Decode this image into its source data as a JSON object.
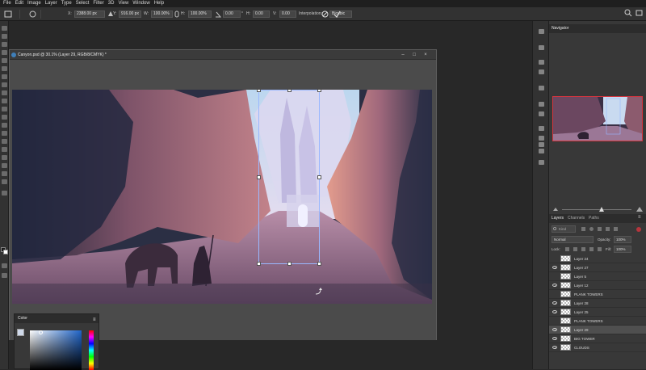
{
  "menu": [
    "File",
    "Edit",
    "Image",
    "Layer",
    "Type",
    "Select",
    "Filter",
    "3D",
    "View",
    "Window",
    "Help"
  ],
  "options": {
    "x_label": "X:",
    "x_value": "2388.00 px",
    "y_label": "Y:",
    "y_value": "916.00 px",
    "w_label": "W:",
    "w_value": "100.00%",
    "h_label": "H:",
    "h_value": "100.00%",
    "angle_value": "0.00",
    "h_skew_label": "H:",
    "h_skew_value": "0.00",
    "v_skew_label": "V:",
    "v_skew_value": "0.00",
    "interpolation_label": "Interpolation:",
    "interpolation_value": "Bicubic"
  },
  "document": {
    "title": "Canyon.psd @ 30.1% (Layer 29, RGB/8/CMYK) *"
  },
  "color_panel": {
    "title": "Color"
  },
  "navigator": {
    "title": "Navigator"
  },
  "layers_panel": {
    "tabs": [
      "Layers",
      "Channels",
      "Paths"
    ],
    "search_placeholder": "Kind",
    "blend_mode": "Normal",
    "opacity_label": "Opacity:",
    "opacity_value": "100%",
    "lock_label": "Lock:",
    "fill_label": "Fill:",
    "fill_value": "100%",
    "layers": [
      {
        "name": "Layer 24",
        "visible": false,
        "selected": false
      },
      {
        "name": "Layer 27",
        "visible": true,
        "selected": false
      },
      {
        "name": "Layer 5",
        "visible": false,
        "selected": false
      },
      {
        "name": "Layer 12",
        "visible": true,
        "selected": false
      },
      {
        "name": "PLANK TOWERS",
        "visible": false,
        "selected": false
      },
      {
        "name": "Layer 28",
        "visible": true,
        "selected": false
      },
      {
        "name": "Layer 25",
        "visible": true,
        "selected": false
      },
      {
        "name": "PLANK TOWERS",
        "visible": false,
        "selected": false
      },
      {
        "name": "Layer 29",
        "visible": true,
        "selected": true
      },
      {
        "name": "BIG TOWER",
        "visible": true,
        "selected": false
      },
      {
        "name": "CLOUDS",
        "visible": true,
        "selected": false
      }
    ]
  },
  "colors": {
    "accent": "#d5353e",
    "selection": "#4f4f4f"
  }
}
